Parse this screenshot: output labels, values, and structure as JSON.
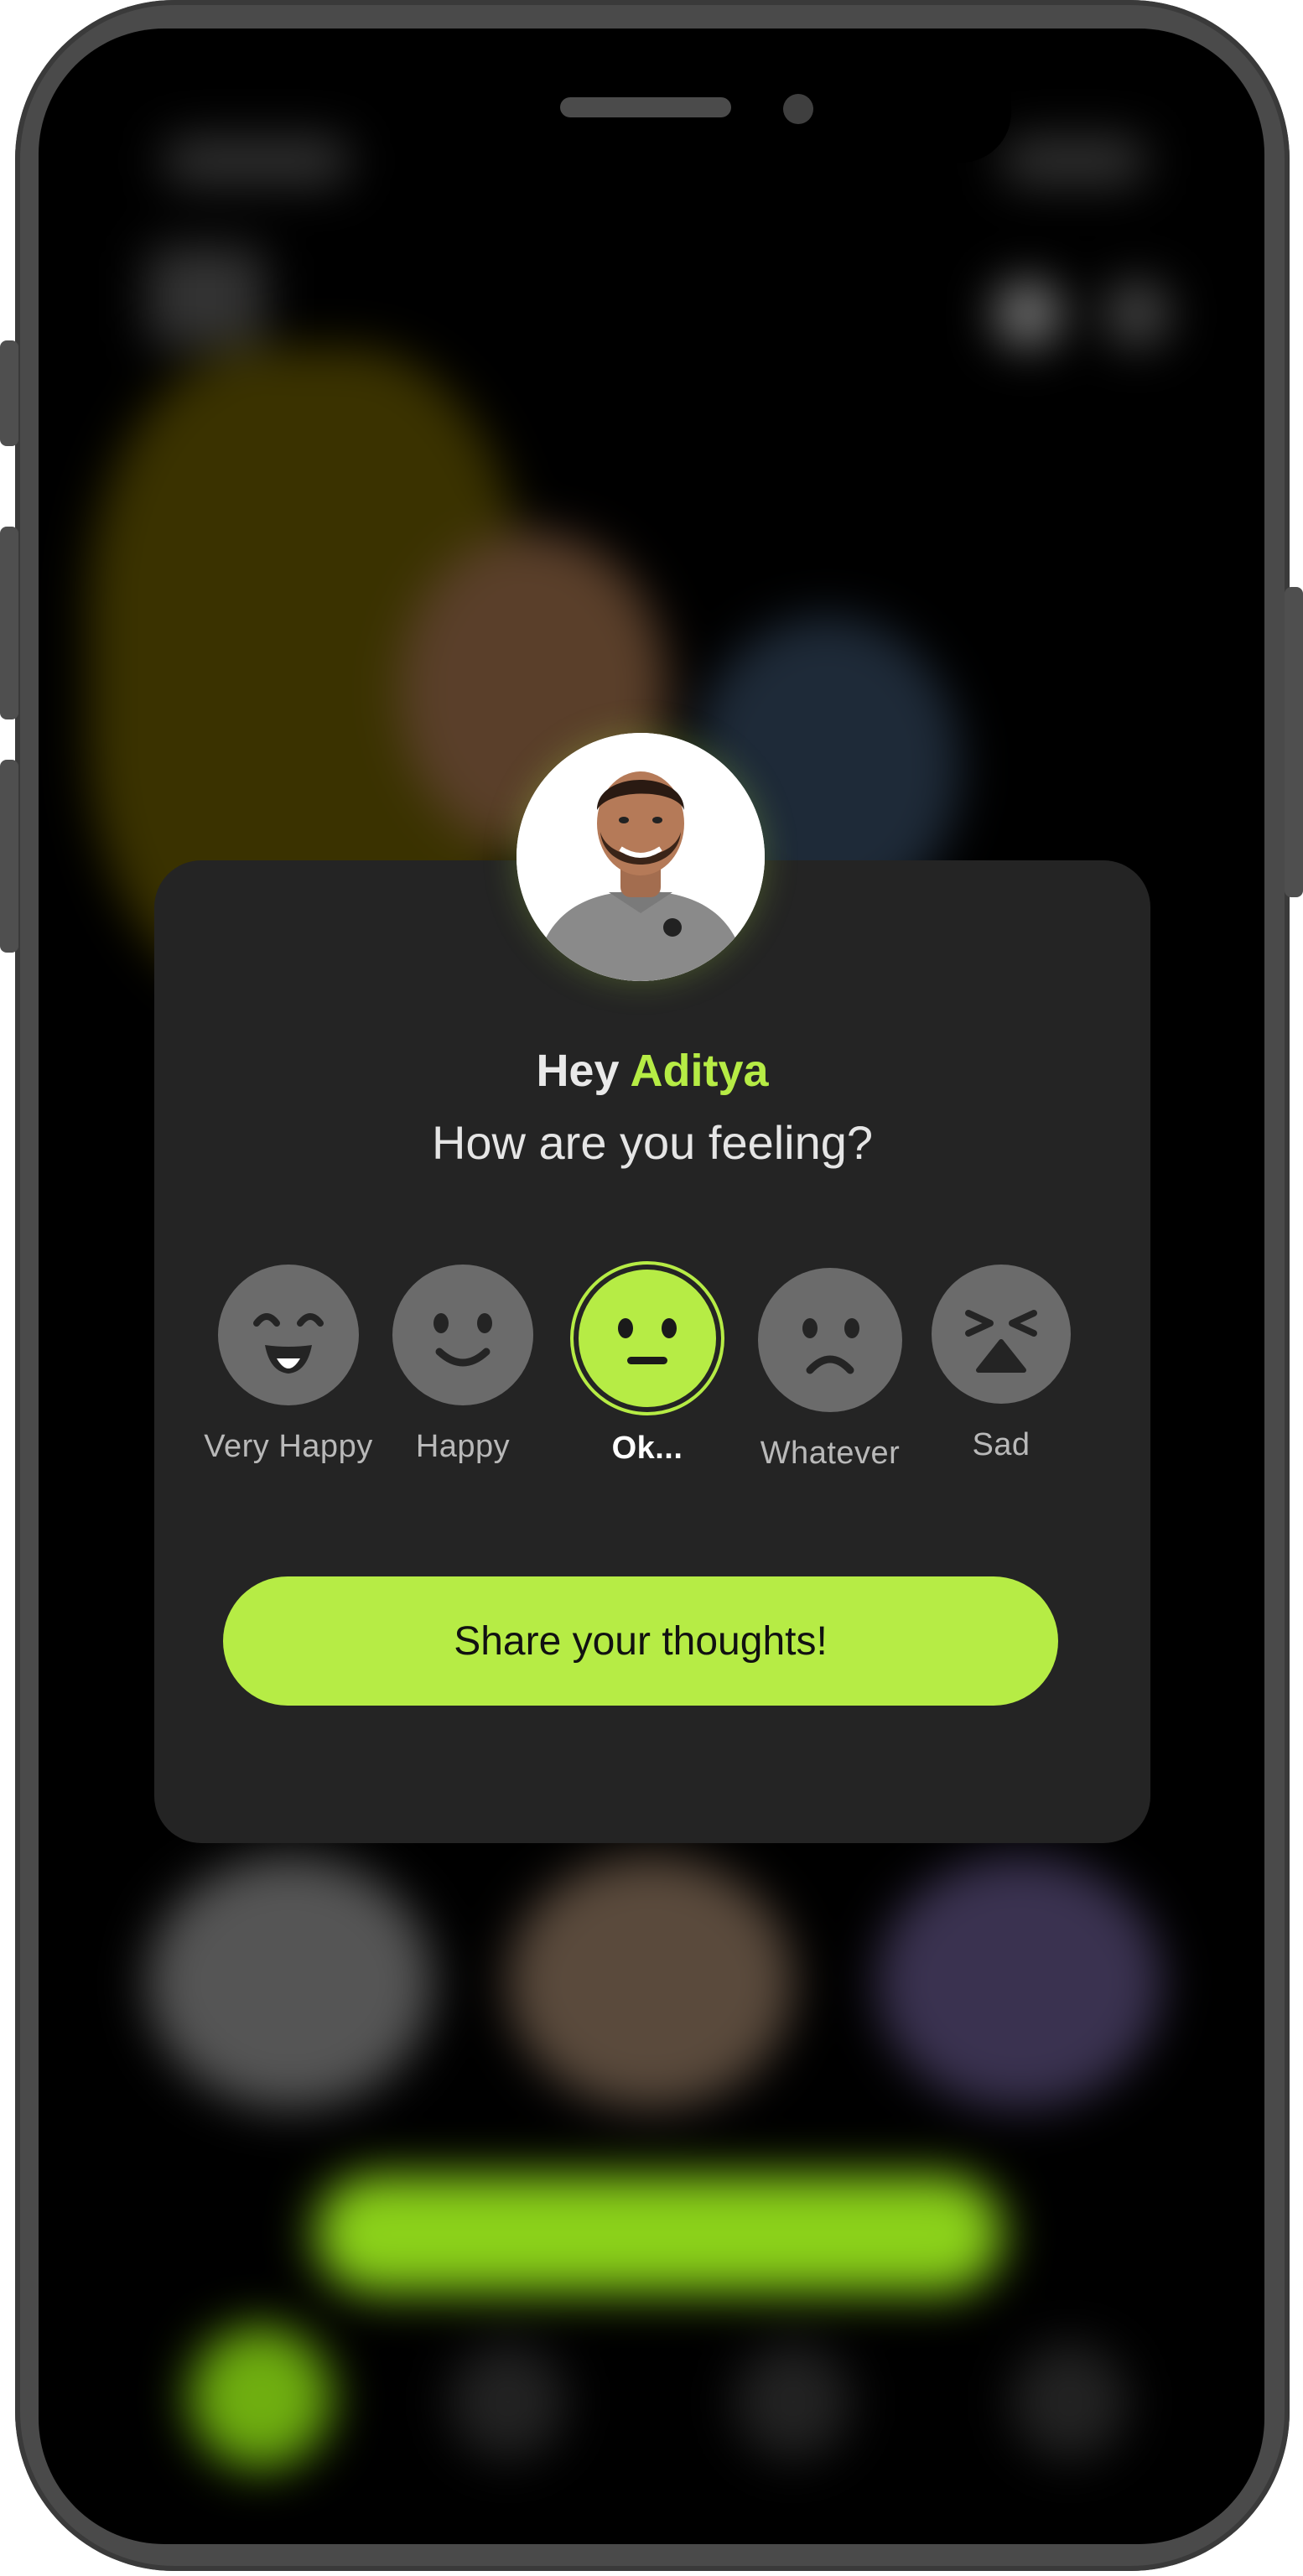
{
  "greeting": {
    "hey": "Hey ",
    "name": "Aditya"
  },
  "question": "How are you feeling?",
  "moods": [
    {
      "label": "Very Happy",
      "icon": "very-happy-face-icon"
    },
    {
      "label": "Happy",
      "icon": "happy-face-icon"
    },
    {
      "label": "Ok...",
      "icon": "neutral-face-icon",
      "selected": true
    },
    {
      "label": "Whatever",
      "icon": "slightly-sad-face-icon"
    },
    {
      "label": "Sad",
      "icon": "sad-face-icon"
    }
  ],
  "cta_label": "Share your thoughts!",
  "colors": {
    "accent": "#b6ec45",
    "modal_bg": "#242424",
    "face_gray": "#6b6b6b"
  }
}
